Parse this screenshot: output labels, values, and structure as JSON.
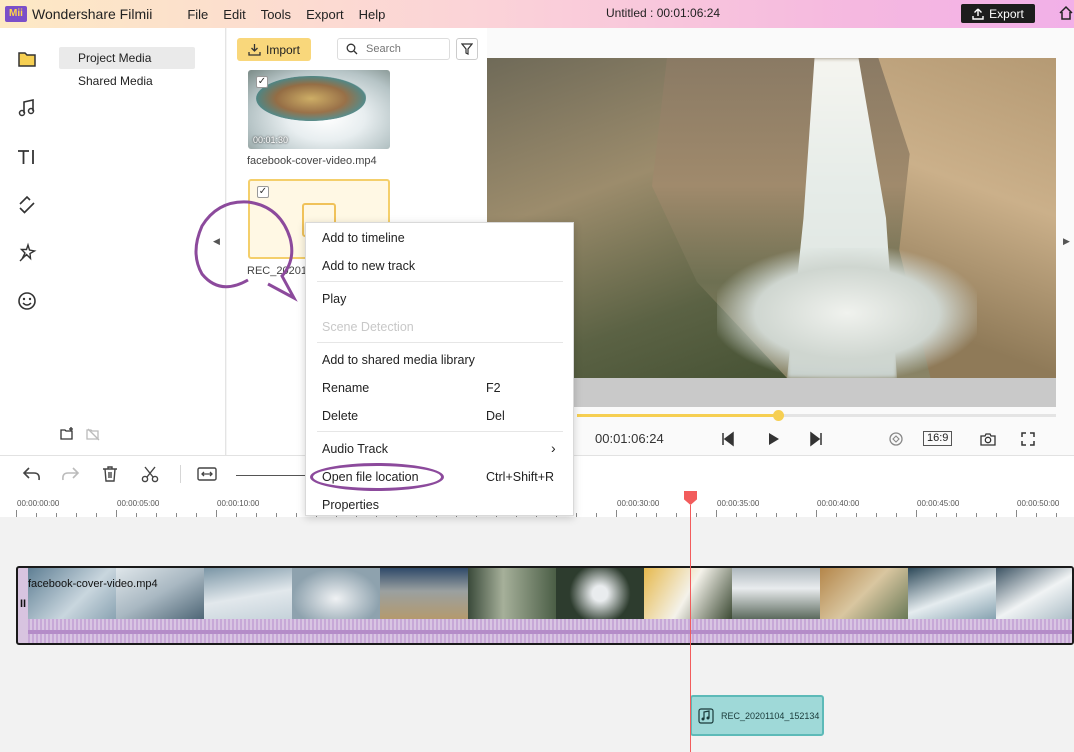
{
  "app": {
    "logo": "Mii",
    "name": "Wondershare Filmii",
    "doc_title": "Untitled :   00:01:06:24",
    "export_label": "Export"
  },
  "menu": [
    "File",
    "Edit",
    "Tools",
    "Export",
    "Help"
  ],
  "nav": {
    "project_media": "Project Media",
    "shared_media": "Shared Media"
  },
  "media": {
    "import_label": "Import",
    "search_placeholder": "Search",
    "items": [
      {
        "name": "facebook-cover-video.mp4",
        "duration": "00:01:30",
        "checked": "✓"
      },
      {
        "name": "REC_20201",
        "checked": "✓"
      }
    ]
  },
  "preview": {
    "timecode": "00:01:06:24",
    "ratio": "16:9",
    "progress": 0.42
  },
  "ruler": [
    "00:00:00:00",
    "00:00:05:00",
    "00:00:10:00",
    "00:00:30:00",
    "00:00:35:00",
    "00:00:40:00",
    "00:00:45:00",
    "00:00:50:00"
  ],
  "timeline": {
    "video_clip": "facebook-cover-video.mp4",
    "audio_clip": "REC_20201104_152134"
  },
  "context_menu": {
    "add_to_timeline": "Add to timeline",
    "add_to_new_track": "Add to new track",
    "play": "Play",
    "scene_detection": "Scene Detection",
    "add_shared": "Add to shared media library",
    "rename": "Rename",
    "rename_sc": "F2",
    "delete": "Delete",
    "delete_sc": "Del",
    "audio_track": "Audio Track",
    "audio_track_arrow": "›",
    "open_location": "Open file location",
    "open_location_sc": "Ctrl+Shift+R",
    "properties": "Properties"
  },
  "colors": {
    "accent": "#f6cf52",
    "annotation": "#8c4a9c",
    "playhead": "#f25c5c",
    "audio_clip": "#9fd9d8"
  }
}
